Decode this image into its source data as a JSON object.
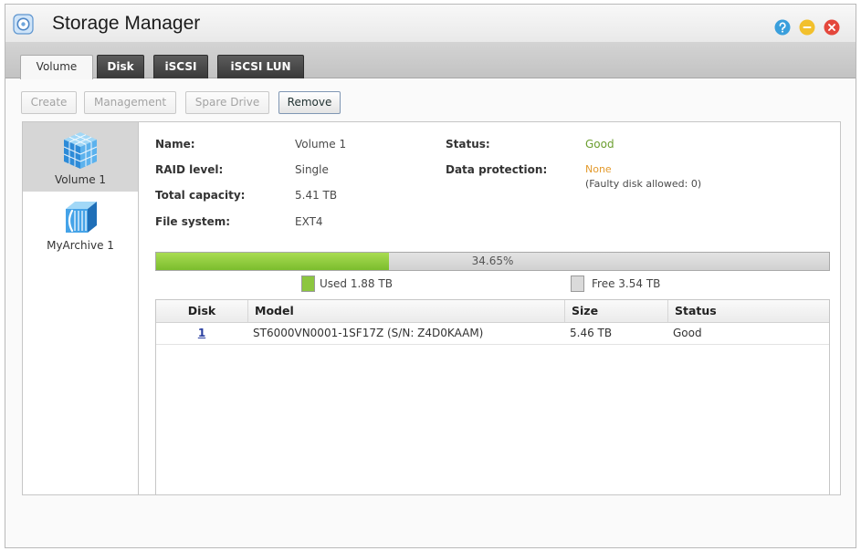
{
  "window": {
    "title": "Storage Manager",
    "app_icon": "storage-manager-icon",
    "controls": [
      "help-icon",
      "minimize-icon",
      "close-icon"
    ]
  },
  "tabs": [
    {
      "label": "Volume",
      "active": true
    },
    {
      "label": "Disk",
      "active": false
    },
    {
      "label": "iSCSI",
      "active": false
    },
    {
      "label": "iSCSI LUN",
      "active": false
    }
  ],
  "toolbar": [
    {
      "label": "Create",
      "disabled": true
    },
    {
      "label": "Management",
      "disabled": true
    },
    {
      "label": "Spare Drive",
      "disabled": true
    },
    {
      "label": "Remove",
      "disabled": false
    }
  ],
  "volumes": [
    {
      "label": "Volume 1",
      "icon": "volume-cube-icon",
      "selected": true
    },
    {
      "label": "MyArchive 1",
      "icon": "archive-icon",
      "selected": false
    }
  ],
  "details": {
    "name": {
      "label": "Name:",
      "value": "Volume 1"
    },
    "raid_level": {
      "label": "RAID level:",
      "value": "Single"
    },
    "total_capacity": {
      "label": "Total capacity:",
      "value": "5.41 TB"
    },
    "file_system": {
      "label": "File system:",
      "value": "EXT4"
    },
    "status": {
      "label": "Status:",
      "value": "Good"
    },
    "data_protection": {
      "label": "Data protection:",
      "value": "None",
      "note": "(Faulty disk allowed: 0)"
    }
  },
  "usage": {
    "used_fraction": 0.3465,
    "percent_label": "34.65%",
    "used_label": "Used 1.88 TB",
    "free_label": "Free 3.54 TB"
  },
  "disk_table": {
    "columns": [
      "Disk",
      "Model",
      "Size",
      "Status"
    ],
    "rows": [
      {
        "disk": "1",
        "model": "ST6000VN0001-1SF17Z (S/N: Z4D0KAAM)",
        "size": "5.46 TB",
        "status": "Good"
      }
    ]
  },
  "colors": {
    "status_good": "#6b9e2f",
    "protection_none": "#e39a2c",
    "usage_used": "#8cc63f",
    "usage_free": "#dadada",
    "link": "#2a3fa0"
  }
}
